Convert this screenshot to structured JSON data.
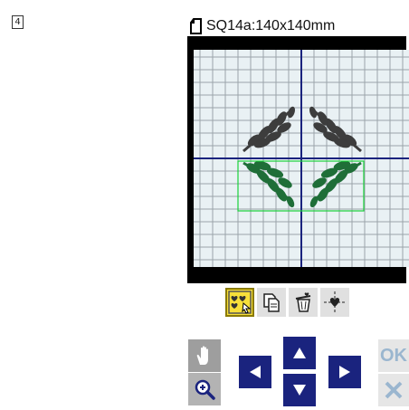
{
  "step_number": "4",
  "header": {
    "title": "SQ14a:140x140mm",
    "icon": "hoop-icon"
  },
  "toolbar": {
    "items": [
      {
        "icon": "group-select-icon",
        "active": true
      },
      {
        "icon": "copy-icon",
        "active": false
      },
      {
        "icon": "delete-icon",
        "active": false
      },
      {
        "icon": "center-icon",
        "active": false
      }
    ]
  },
  "side_buttons": {
    "hand_icon": "hand-icon",
    "zoom_icon": "zoom-in-icon"
  },
  "arrows": {
    "up": "arrow-up-icon",
    "down": "arrow-down-icon",
    "left": "arrow-left-icon",
    "right": "arrow-right-icon"
  },
  "ok_label": "OK",
  "cancel_icon": "close-icon",
  "colors": {
    "grid_bg": "#e9f1f4",
    "grid_line": "#9aa4aa",
    "center_line": "#1a237e",
    "leaf_dark": "#3d3d3d",
    "leaf_green": "#1f6e38",
    "selection": "#19d13a",
    "arrow_bg": "#1a237e",
    "toolbar_active": "#f7df3a"
  }
}
